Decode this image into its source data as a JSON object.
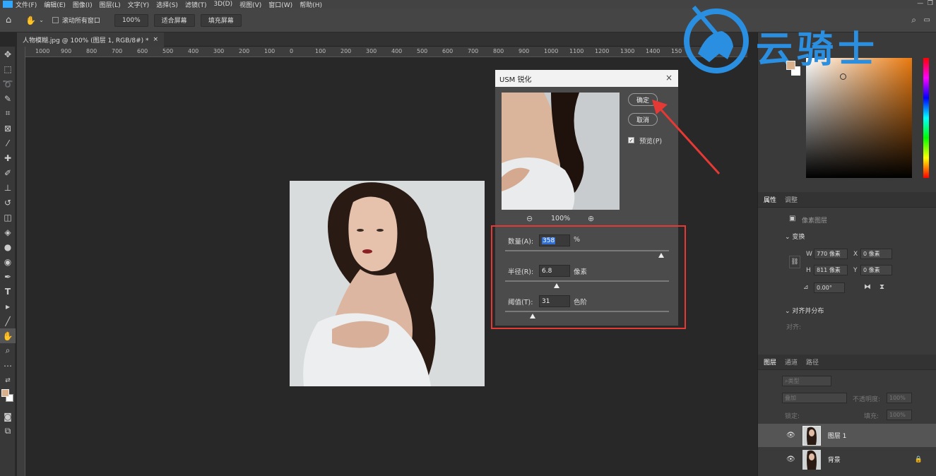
{
  "menu": {
    "items": [
      "文件(F)",
      "编辑(E)",
      "图像(I)",
      "图层(L)",
      "文字(Y)",
      "选择(S)",
      "滤镜(T)",
      "3D(D)",
      "视图(V)",
      "窗口(W)",
      "帮助(H)"
    ]
  },
  "options": {
    "scroll_all": "滚动所有窗口",
    "zoom": "100%",
    "fit_screen": "适合屏幕",
    "fill_screen": "填充屏幕"
  },
  "document": {
    "tab_title": "人物模糊.jpg @ 100% (图层 1, RGB/8#) *"
  },
  "ruler": {
    "h_ticks": [
      "1000",
      "900",
      "800",
      "700",
      "600",
      "500",
      "400",
      "300",
      "200",
      "100",
      "0",
      "100",
      "200",
      "300",
      "400",
      "500",
      "600",
      "700",
      "800",
      "900",
      "1000",
      "1100",
      "1200",
      "1300",
      "1400",
      "150"
    ]
  },
  "dialog": {
    "title": "USM 锐化",
    "ok": "确定",
    "cancel": "取消",
    "preview_label": "预览(P)",
    "preview_checked": true,
    "zoom": "100%",
    "amount_label": "数量(A):",
    "amount_value": "358",
    "amount_unit": "%",
    "radius_label": "半径(R):",
    "radius_value": "6.8",
    "radius_unit": "像素",
    "threshold_label": "阈值(T):",
    "threshold_value": "31",
    "threshold_unit": "色阶"
  },
  "watermark": {
    "text": "云骑士"
  },
  "properties": {
    "tab_properties": "属性",
    "tab_adjust": "调整",
    "layer_type": "像素图层",
    "transform_header": "变换",
    "w_label": "W",
    "w_value": "770 像素",
    "h_label": "H",
    "h_value": "811 像素",
    "x_label": "X",
    "x_value": "0 像素",
    "y_label": "Y",
    "y_value": "0 像素",
    "angle": "0.00°",
    "align_header": "对齐并分布",
    "align_label": "对齐:"
  },
  "layers": {
    "tab_layers": "图层",
    "tab_channels": "通道",
    "tab_paths": "路径",
    "kind": "类型",
    "blend": "叠加",
    "opacity_label": "不透明度:",
    "opacity": "100%",
    "lock_label": "锁定:",
    "fill_label": "填充:",
    "fill": "100%",
    "items": [
      {
        "name": "图层 1"
      },
      {
        "name": "背景"
      }
    ]
  },
  "colors": {
    "foreground": "#d9b08c",
    "accent_red": "#e53935",
    "logo_blue": "#2a8fe0"
  }
}
